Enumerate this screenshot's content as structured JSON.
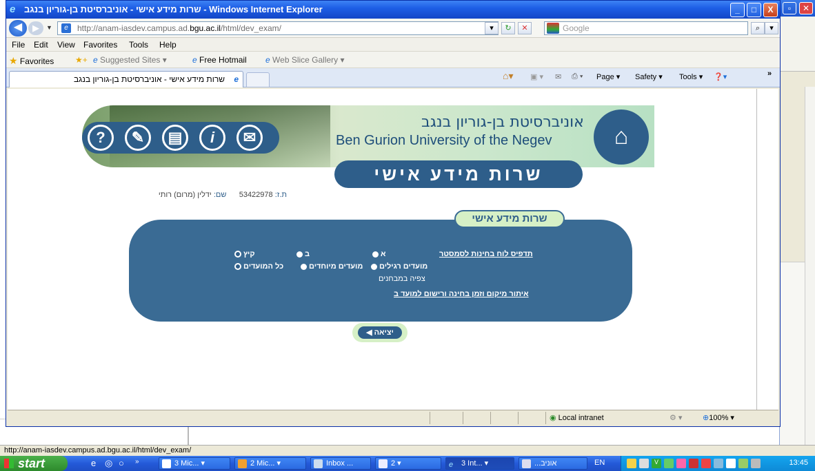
{
  "window": {
    "title": "שרות מידע אישי - אוניברסיטת בן-גוריון בנגב - Windows Internet Explorer",
    "minimize": "_",
    "maximize": "□",
    "close": "X"
  },
  "address": {
    "url_prefix": "http://anam-iasdev.campus.ad.",
    "url_domain": "bgu.ac.il",
    "url_suffix": "/html/dev_exam/",
    "search_placeholder": "Google"
  },
  "menu": [
    "File",
    "Edit",
    "View",
    "Favorites",
    "Tools",
    "Help"
  ],
  "favorites_bar": {
    "favorites": "Favorites",
    "suggested": "Suggested Sites ▾",
    "hotmail": "Free Hotmail",
    "slice": "Web Slice Gallery ▾"
  },
  "tab": {
    "label": "שרות מידע אישי - אוניברסיטת בן-גוריון בנגב"
  },
  "command_bar": {
    "page": "Page ▾",
    "safety": "Safety ▾",
    "tools": "Tools ▾",
    "help": "❓▾",
    "more": "»"
  },
  "page": {
    "univ_he": "אוניברסיטת בן-גוריון בנגב",
    "univ_en": "Ben Gurion University of the Negev",
    "service_title": "שרות מידע אישי",
    "panel_title": "שרות מידע אישי",
    "id_label": "ת.ז:",
    "id_value": "53422978",
    "name_label": "שם:",
    "name_value": "ידלין (מרום) רותי",
    "print_link": "תדפיס לוח בחינות לסמסטר",
    "sem_a": "א",
    "sem_b": "ב",
    "sem_summer": "קיץ",
    "regular": "מועדים רגילים",
    "special": "מועדים מיוחדים",
    "all": "כל המועדים",
    "view_exams": "צפיה במבחנים",
    "locate_link": "איתור מיקום וזמן בחינה ורישום למועד ב",
    "exit": "יציאה"
  },
  "status": {
    "zone": "Local intranet",
    "zoom": "100%",
    "hover_url": "http://anam-iasdev.campus.ad.bgu.ac.il/html/dev_exam/"
  },
  "taskbar": {
    "start": "start",
    "buttons": [
      "3 Mic...",
      "2 Mic...",
      "Inbox ...",
      "2",
      "3 Int...",
      "...אוניב"
    ],
    "lang": "EN",
    "time": "13:45"
  },
  "colors": {
    "brand": "#2e5e8a",
    "accent_green": "#d6f0c6",
    "title_blue": "#1e5fe6"
  }
}
